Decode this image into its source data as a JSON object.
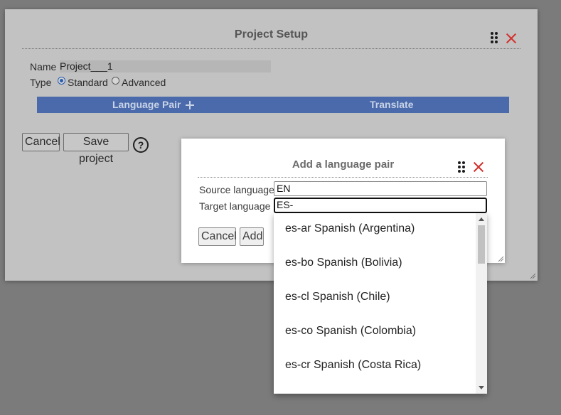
{
  "project_setup": {
    "title": "Project Setup",
    "name_label": "Name",
    "name_value": "Project___1",
    "type_label": "Type",
    "type_standard": "Standard",
    "type_advanced": "Advanced",
    "type_selected": "Standard",
    "columns": [
      "Language Pair",
      "Translate"
    ],
    "cancel_label": "Cancel",
    "save_label": "Save project",
    "help_label": "?"
  },
  "add_pair": {
    "title": "Add a language pair",
    "source_label": "Source language",
    "source_value": "EN",
    "target_label": "Target language",
    "target_value": "ES-",
    "cancel_label": "Cancel",
    "add_label": "Add"
  },
  "dropdown": {
    "options": [
      "es-ar Spanish (Argentina)",
      "es-bo Spanish (Bolivia)",
      "es-cl Spanish (Chile)",
      "es-co Spanish (Colombia)",
      "es-cr Spanish (Costa Rica)"
    ]
  },
  "colors": {
    "header_bar": "#4a6aab",
    "close_icon": "#d2322d",
    "overlay": "#7b7b7b"
  }
}
